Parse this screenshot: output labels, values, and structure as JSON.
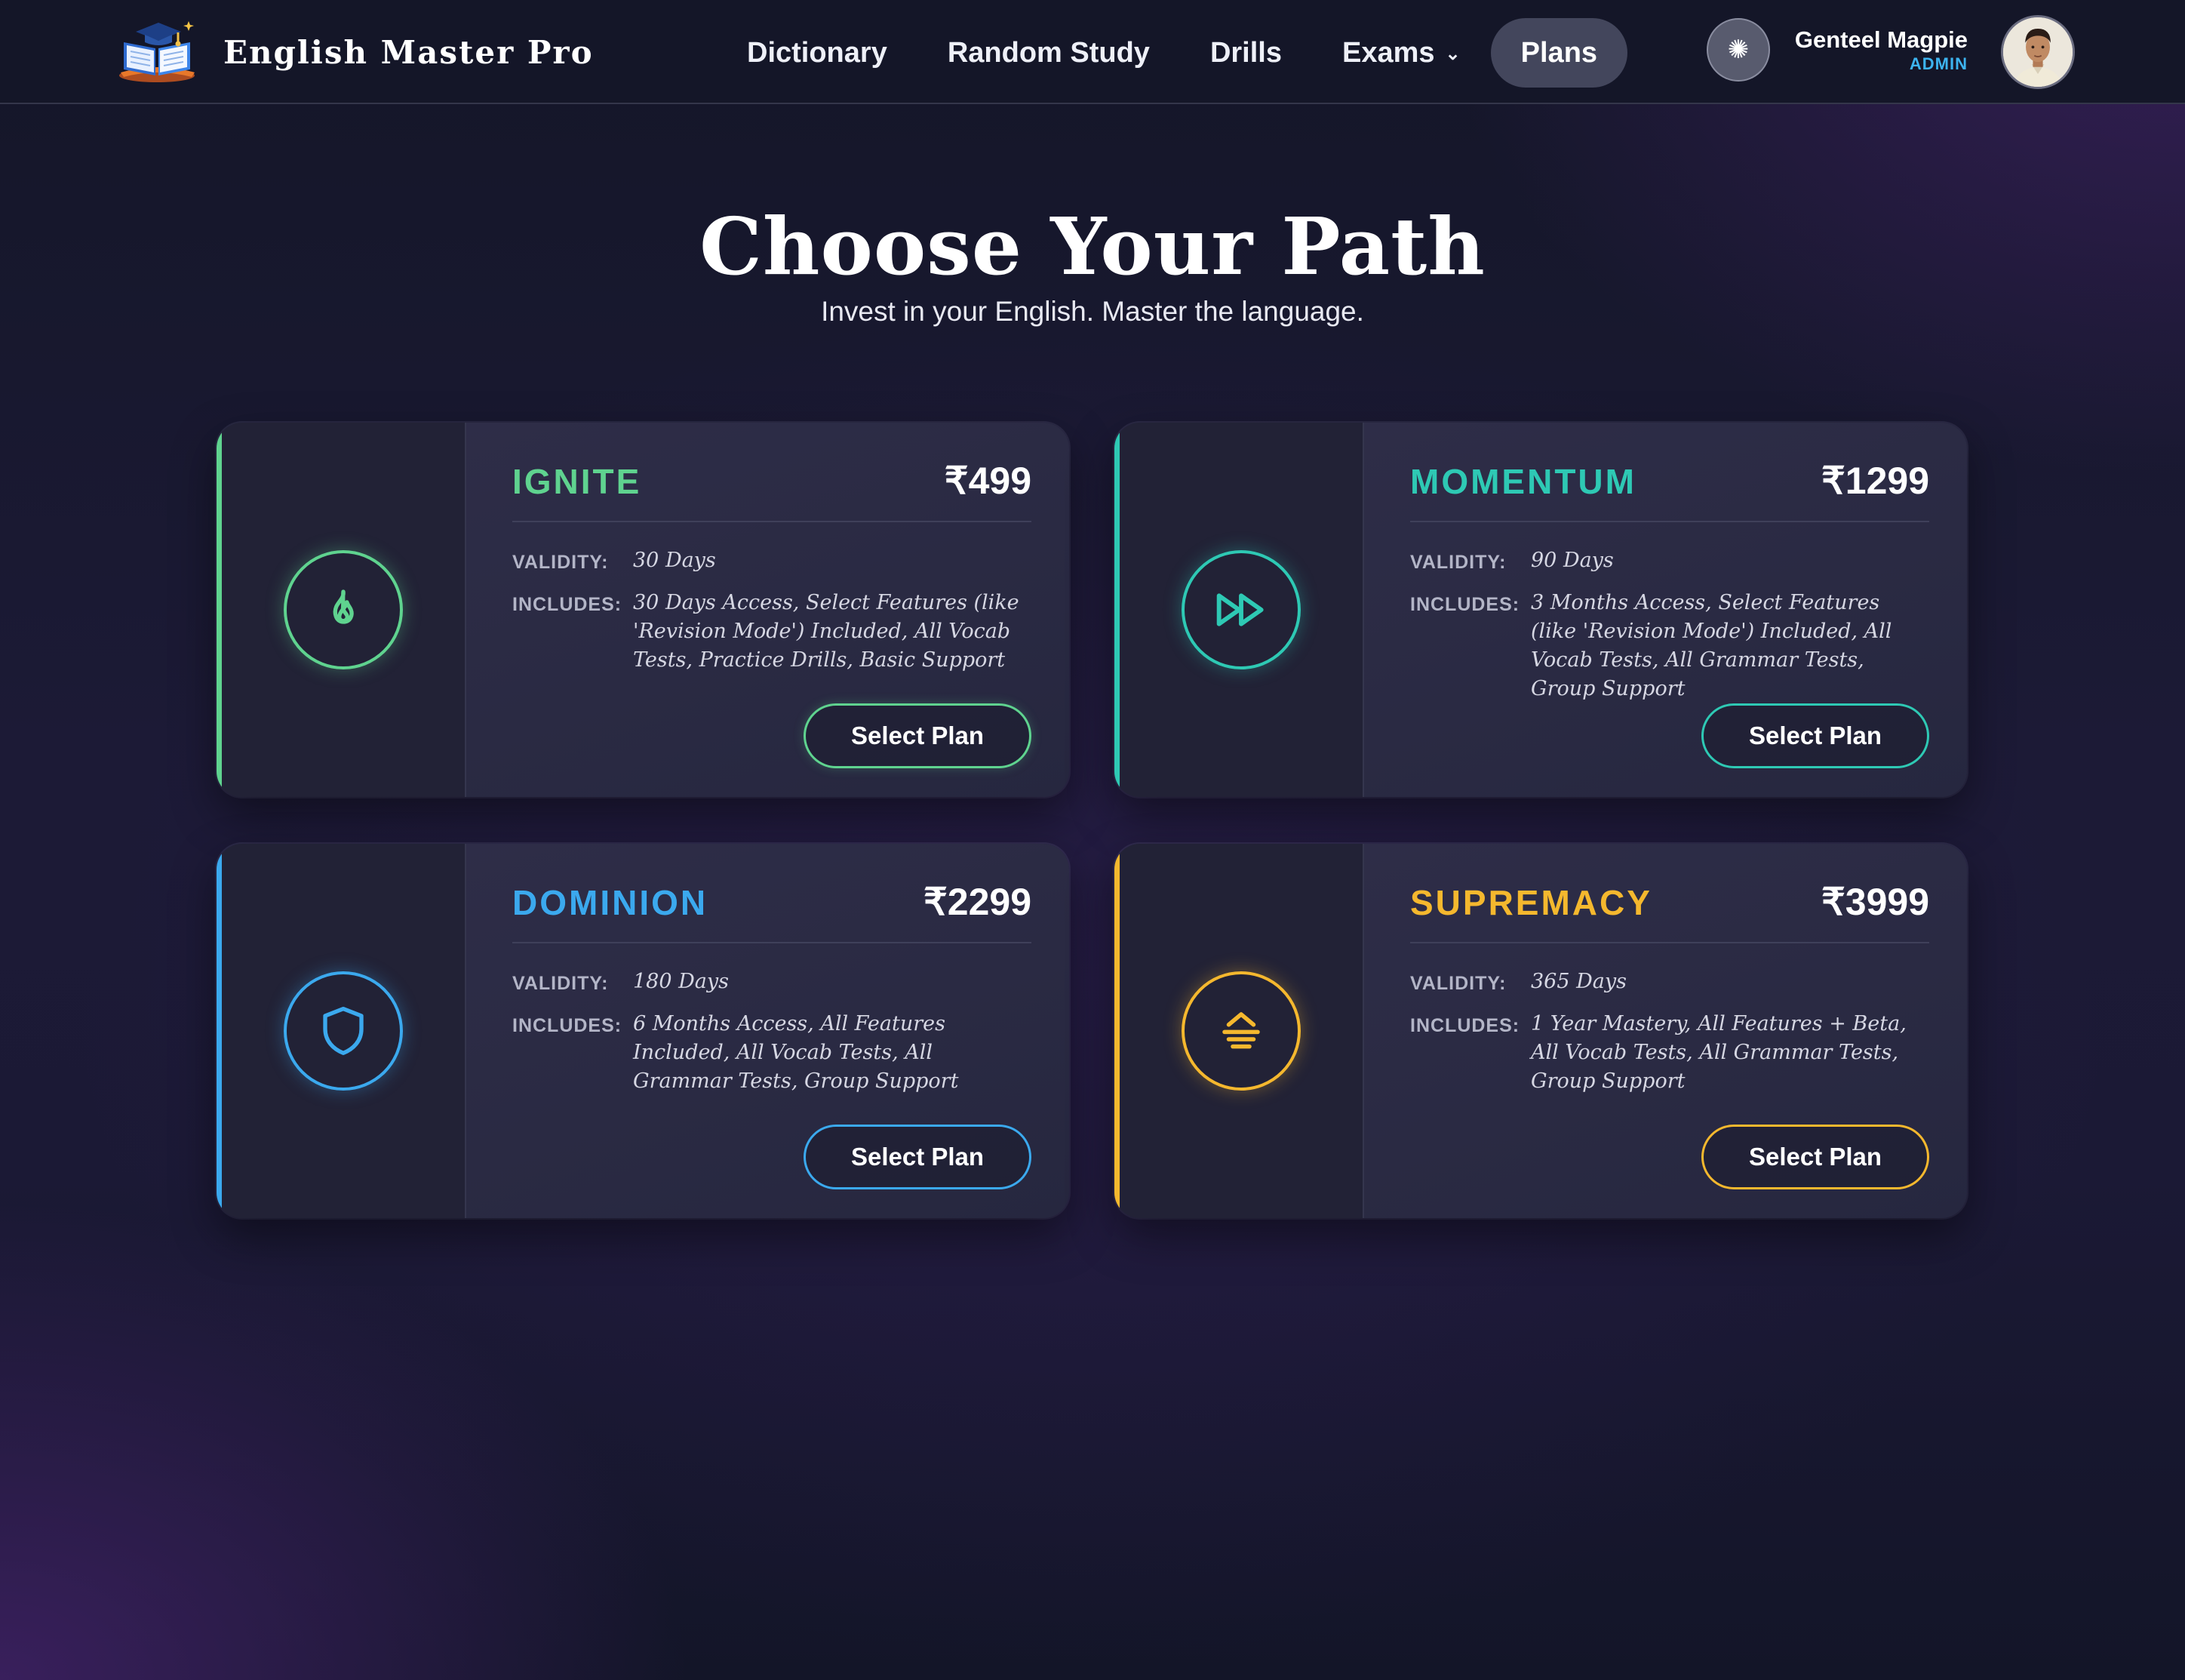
{
  "brand": {
    "title": "English Master Pro",
    "logo_icon": "graduation-book-icon"
  },
  "nav": {
    "items": [
      {
        "label": "Dictionary"
      },
      {
        "label": "Random Study"
      },
      {
        "label": "Drills"
      },
      {
        "label": "Exams",
        "has_dropdown": true
      },
      {
        "label": "Plans",
        "active": true
      }
    ]
  },
  "theme_toggle": {
    "icon": "sun-icon",
    "glyph": "✺"
  },
  "user": {
    "name": "Genteel Magpie",
    "role": "ADMIN",
    "avatar_icon": "user-avatar"
  },
  "hero": {
    "title": "Choose Your Path",
    "subtitle": "Invest in your English. Master the language."
  },
  "plans": [
    {
      "name": "IGNITE",
      "price": "₹499",
      "validity_label": "VALIDITY:",
      "validity": "30 Days",
      "includes_label": "INCLUDES:",
      "includes": "30 Days Access, Select Features (like 'Revision Mode') Included, All Vocab Tests, Practice Drills, Basic Support",
      "button_label": "Select Plan",
      "icon": "flame-icon",
      "accent_color": "#5fd38f"
    },
    {
      "name": "MOMENTUM",
      "price": "₹1299",
      "validity_label": "VALIDITY:",
      "validity": "90 Days",
      "includes_label": "INCLUDES:",
      "includes": "3 Months Access, Select Features (like 'Revision Mode') Included, All Vocab Tests, All Grammar Tests, Group Support",
      "button_label": "Select Plan",
      "icon": "fast-forward-icon",
      "accent_color": "#2ec9b4"
    },
    {
      "name": "DOMINION",
      "price": "₹2299",
      "validity_label": "VALIDITY:",
      "validity": "180 Days",
      "includes_label": "INCLUDES:",
      "includes": "6 Months Access, All Features Included, All Vocab Tests, All Grammar Tests, Group Support",
      "button_label": "Select Plan",
      "icon": "shield-icon",
      "accent_color": "#3ba9ee"
    },
    {
      "name": "SUPREMACY",
      "price": "₹3999",
      "validity_label": "VALIDITY:",
      "validity": "365 Days",
      "includes_label": "INCLUDES:",
      "includes": "1 Year Mastery, All Features + Beta, All Vocab Tests, All Grammar Tests, Group Support",
      "button_label": "Select Plan",
      "icon": "chevron-up-stack-icon",
      "accent_color": "#f5b82e"
    }
  ]
}
